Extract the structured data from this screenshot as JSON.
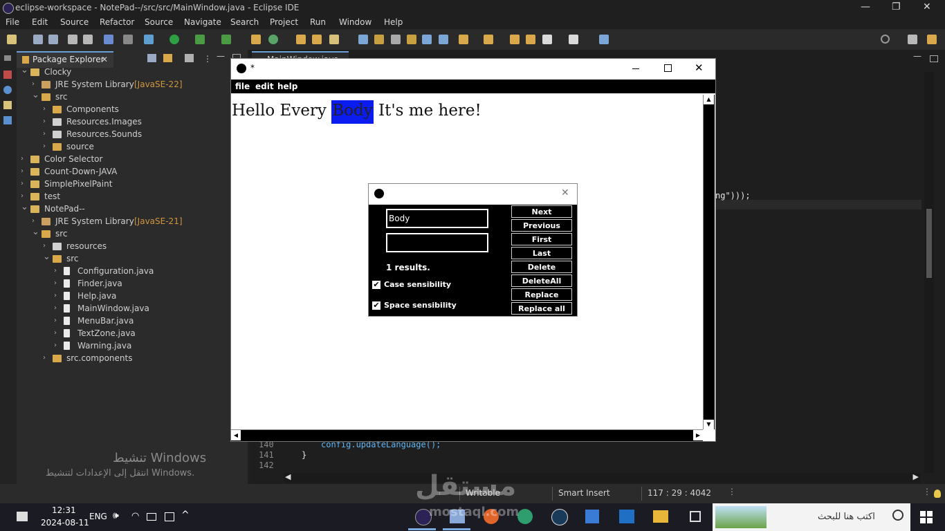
{
  "titlebar": {
    "title": "eclipse-workspace - NotePad--/src/src/MainWindow.java - Eclipse IDE",
    "min": "—",
    "max": "❐",
    "close": "✕"
  },
  "menubar": [
    "File",
    "Edit",
    "Source",
    "Refactor",
    "Source",
    "Navigate",
    "Search",
    "Project",
    "Run",
    "Window",
    "Help"
  ],
  "explorer": {
    "tab": "Package Explorer",
    "close": "✕",
    "rows": [
      {
        "label": "Clocky",
        "dec": ""
      },
      {
        "label": "JRE System Library ",
        "dec": "[JavaSE-22]"
      },
      {
        "label": "src",
        "dec": ""
      },
      {
        "label": "Components",
        "dec": ""
      },
      {
        "label": "Resources.Images",
        "dec": ""
      },
      {
        "label": "Resources.Sounds",
        "dec": ""
      },
      {
        "label": "source",
        "dec": ""
      },
      {
        "label": "Color Selector",
        "dec": ""
      },
      {
        "label": "Count-Down-JAVA",
        "dec": ""
      },
      {
        "label": "SimplePixelPaint",
        "dec": ""
      },
      {
        "label": "test",
        "dec": ""
      },
      {
        "label": "NotePad--",
        "dec": ""
      },
      {
        "label": "JRE System Library ",
        "dec": "[JavaSE-21]"
      },
      {
        "label": "src",
        "dec": ""
      },
      {
        "label": "resources",
        "dec": ""
      },
      {
        "label": "src",
        "dec": ""
      },
      {
        "label": "Configuration.java",
        "dec": ""
      },
      {
        "label": "Finder.java",
        "dec": ""
      },
      {
        "label": "Help.java",
        "dec": ""
      },
      {
        "label": "MainWindow.java",
        "dec": ""
      },
      {
        "label": "MenuBar.java",
        "dec": ""
      },
      {
        "label": "TextZone.java",
        "dec": ""
      },
      {
        "label": "Warning.java",
        "dec": ""
      },
      {
        "label": "src.components",
        "dec": ""
      }
    ]
  },
  "editor": {
    "tab": "MainWindow.java",
    "code_fragment": "ng\")));",
    "lines": [
      {
        "num": "140",
        "code": "config.updateLanguage();"
      },
      {
        "num": "141",
        "code": "}"
      },
      {
        "num": "142",
        "code": ""
      }
    ]
  },
  "watermark": {
    "line1": "تنشيط Windows",
    "line2": "انتقل إلى الإعدادات لتنشيط Windows."
  },
  "statusbar": {
    "writable": "Writable",
    "insert": "Smart Insert",
    "position": "117 : 29 : 4042"
  },
  "taskbar": {
    "time": "12:31",
    "date": "2024-08-11",
    "lang": "ENG",
    "search_placeholder": "اكتب هنا للبحث"
  },
  "notepad": {
    "title": "*",
    "menu": [
      "file",
      "edit",
      "help"
    ],
    "text_before": "Hello Every ",
    "text_highlight": "Body",
    "text_after": " It's me here!",
    "colors": {
      "highlight": "#0a1cf0"
    }
  },
  "finder": {
    "close": "✕",
    "search_value": "Body",
    "replace_value": "",
    "results": "1 results.",
    "case_label": "Case sensibility",
    "space_label": "Space sensibility",
    "case_checked": "✔",
    "space_checked": "✔",
    "buttons": [
      "Next",
      "Previous",
      "First",
      "Last",
      "Delete",
      "DeleteAll",
      "Replace",
      "Replace all"
    ]
  },
  "brand_watermark": {
    "text": "مستقل",
    "sub": "mostaql.com"
  }
}
